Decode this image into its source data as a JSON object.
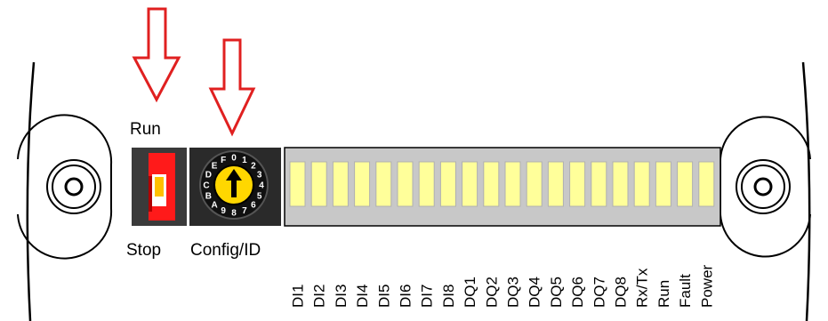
{
  "labels": {
    "run": "Run",
    "stop": "Stop",
    "config_id": "Config/ID"
  },
  "rotary_switch": {
    "digits": [
      "0",
      "1",
      "2",
      "3",
      "4",
      "5",
      "6",
      "7",
      "8",
      "9",
      "A",
      "B",
      "C",
      "D",
      "E",
      "F"
    ]
  },
  "led_labels": [
    "DI1",
    "DI2",
    "DI3",
    "DI4",
    "DI5",
    "DI6",
    "DI7",
    "DI8",
    "DQ1",
    "DQ2",
    "DQ3",
    "DQ4",
    "DQ5",
    "DQ6",
    "DQ7",
    "DQ8",
    "Rx/Tx",
    "Run",
    "Fault",
    "Power"
  ],
  "colors": {
    "arrow": "#e02020",
    "switch_body": "#ff1a1a",
    "switch_knob": "#ffc000",
    "dial_face": "#ffd700",
    "led_fill": "#ffff9a",
    "led_panel": "#c8c8c8",
    "device_dark": "#3a3a3a"
  }
}
